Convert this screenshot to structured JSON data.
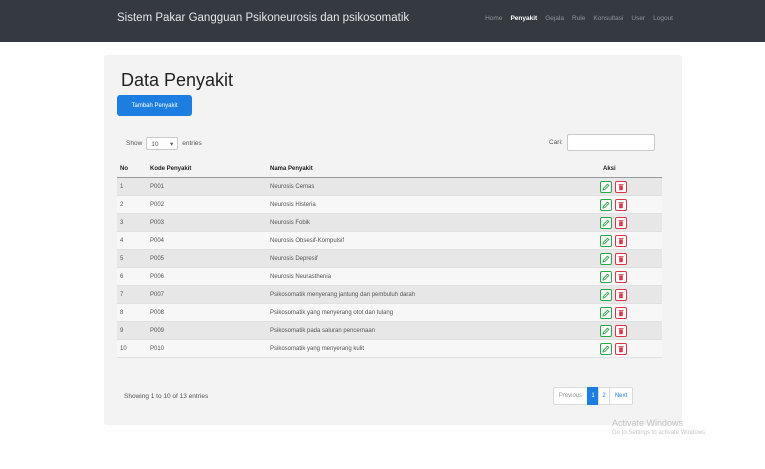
{
  "navbar": {
    "brand": "Sistem Pakar Gangguan Psikoneurosis dan psikosomatik",
    "items": [
      {
        "label": "Home",
        "active": false
      },
      {
        "label": "Penyakit",
        "active": true
      },
      {
        "label": "Gejala",
        "active": false
      },
      {
        "label": "Rule",
        "active": false
      },
      {
        "label": "Konsultasi",
        "active": false
      },
      {
        "label": "User",
        "active": false
      },
      {
        "label": "Logout",
        "active": false
      }
    ]
  },
  "page": {
    "title": "Data Penyakit",
    "add_button": "Tambah Penyakit"
  },
  "table_controls": {
    "show_label": "Show",
    "length_value": "10",
    "entries_label": "entries",
    "search_label": "Cari:",
    "search_value": ""
  },
  "table": {
    "headers": [
      "No",
      "Kode Penyakit",
      "Nama Penyakit",
      "Aksi"
    ],
    "rows": [
      {
        "no": "1",
        "kode": "P001",
        "nama": "Neurosis Cemas"
      },
      {
        "no": "2",
        "kode": "P002",
        "nama": "Neurosis Histeria"
      },
      {
        "no": "3",
        "kode": "P003",
        "nama": "Neurosis Fobik"
      },
      {
        "no": "4",
        "kode": "P004",
        "nama": "Neurosis Obsesif-Kompulsif"
      },
      {
        "no": "5",
        "kode": "P005",
        "nama": "Neurosis Depresif"
      },
      {
        "no": "6",
        "kode": "P006",
        "nama": "Neurosis Neurasthenia"
      },
      {
        "no": "7",
        "kode": "P007",
        "nama": "Psikosomatik menyerang jantung dan pembuluh darah"
      },
      {
        "no": "8",
        "kode": "P008",
        "nama": "Psikosomatik yang menyerang otot dan tulang"
      },
      {
        "no": "9",
        "kode": "P009",
        "nama": "Psikosomatik pada saluran pencernaan"
      },
      {
        "no": "10",
        "kode": "P010",
        "nama": "Psikosomatik yang menyerang kulit"
      }
    ]
  },
  "footer": {
    "info": "Showing 1 to 10 of 13 entries",
    "pagination": {
      "previous": "Previous",
      "pages": [
        {
          "label": "1",
          "active": true
        },
        {
          "label": "2",
          "active": false
        }
      ],
      "next": "Next"
    }
  },
  "watermark": {
    "title": "Activate Windows",
    "subtitle": "Go to Settings to activate Windows."
  },
  "colors": {
    "navbar": "#343a40",
    "primary": "#1e7de0",
    "edit": "#28a745",
    "delete": "#dc3545"
  },
  "icons": {
    "edit": "pencil-icon",
    "delete": "trash-icon"
  }
}
